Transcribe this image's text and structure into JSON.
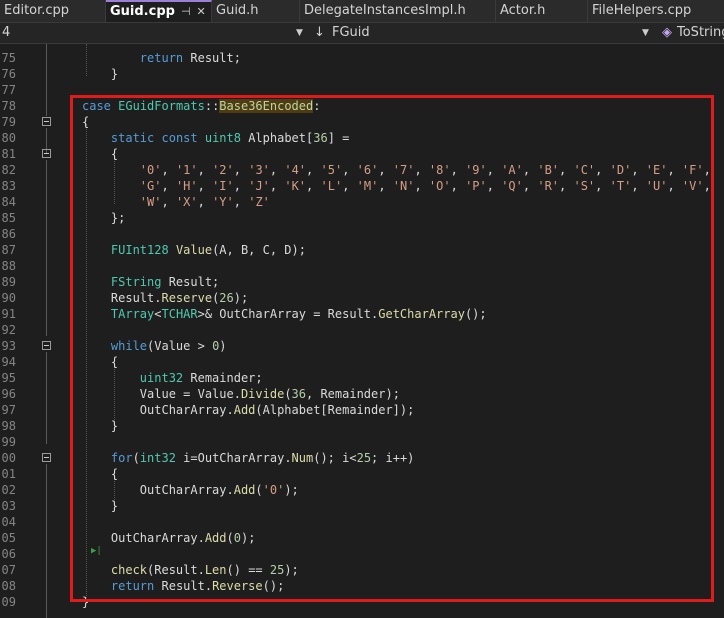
{
  "tabs": [
    {
      "label": "Editor.cpp",
      "active": false
    },
    {
      "label": "Guid.cpp",
      "active": true
    },
    {
      "label": "Guid.h",
      "active": false
    },
    {
      "label": "DelegateInstancesImpl.h",
      "active": false
    },
    {
      "label": "Actor.h",
      "active": false
    },
    {
      "label": "FileHelpers.cpp",
      "active": false
    }
  ],
  "tab_icons": {
    "pin": "pin-icon",
    "close": "close-icon"
  },
  "navbar": {
    "project": "4",
    "scope": "FGuid",
    "member": "ToString"
  },
  "highlight_color": "#e01b1b",
  "lines": [
    {
      "num": "75",
      "tokens": [
        [
          "        ",
          "d"
        ],
        [
          "return",
          "k"
        ],
        [
          " Result",
          "d"
        ],
        [
          ";",
          "d"
        ]
      ]
    },
    {
      "num": "76",
      "tokens": [
        [
          "    }",
          "d"
        ]
      ]
    },
    {
      "num": "77",
      "tokens": [
        [
          "",
          "d"
        ]
      ]
    },
    {
      "num": "78",
      "tokens": [
        [
          "case",
          "k"
        ],
        [
          " ",
          "d"
        ],
        [
          "EGuidFormats",
          "t"
        ],
        [
          "::",
          "d"
        ],
        [
          "Base36Encoded",
          "enumv"
        ],
        [
          ":",
          "d"
        ]
      ]
    },
    {
      "num": "79",
      "tokens": [
        [
          "{",
          "d"
        ]
      ]
    },
    {
      "num": "80",
      "tokens": [
        [
          "    ",
          "d"
        ],
        [
          "static",
          "k"
        ],
        [
          " ",
          "d"
        ],
        [
          "const",
          "k"
        ],
        [
          " ",
          "d"
        ],
        [
          "uint8",
          "t"
        ],
        [
          " Alphabet[",
          "d"
        ],
        [
          "36",
          "n"
        ],
        [
          "] =",
          "d"
        ]
      ]
    },
    {
      "num": "81",
      "tokens": [
        [
          "    {",
          "d"
        ]
      ]
    },
    {
      "num": "82",
      "tokens": [
        [
          "        ",
          "d"
        ],
        [
          "'0'",
          "s"
        ],
        [
          ", ",
          "d"
        ],
        [
          "'1'",
          "s"
        ],
        [
          ", ",
          "d"
        ],
        [
          "'2'",
          "s"
        ],
        [
          ", ",
          "d"
        ],
        [
          "'3'",
          "s"
        ],
        [
          ", ",
          "d"
        ],
        [
          "'4'",
          "s"
        ],
        [
          ", ",
          "d"
        ],
        [
          "'5'",
          "s"
        ],
        [
          ", ",
          "d"
        ],
        [
          "'6'",
          "s"
        ],
        [
          ", ",
          "d"
        ],
        [
          "'7'",
          "s"
        ],
        [
          ", ",
          "d"
        ],
        [
          "'8'",
          "s"
        ],
        [
          ", ",
          "d"
        ],
        [
          "'9'",
          "s"
        ],
        [
          ", ",
          "d"
        ],
        [
          "'A'",
          "s"
        ],
        [
          ", ",
          "d"
        ],
        [
          "'B'",
          "s"
        ],
        [
          ", ",
          "d"
        ],
        [
          "'C'",
          "s"
        ],
        [
          ", ",
          "d"
        ],
        [
          "'D'",
          "s"
        ],
        [
          ", ",
          "d"
        ],
        [
          "'E'",
          "s"
        ],
        [
          ", ",
          "d"
        ],
        [
          "'F'",
          "s"
        ],
        [
          ",",
          "d"
        ]
      ]
    },
    {
      "num": "83",
      "tokens": [
        [
          "        ",
          "d"
        ],
        [
          "'G'",
          "s"
        ],
        [
          ", ",
          "d"
        ],
        [
          "'H'",
          "s"
        ],
        [
          ", ",
          "d"
        ],
        [
          "'I'",
          "s"
        ],
        [
          ", ",
          "d"
        ],
        [
          "'J'",
          "s"
        ],
        [
          ", ",
          "d"
        ],
        [
          "'K'",
          "s"
        ],
        [
          ", ",
          "d"
        ],
        [
          "'L'",
          "s"
        ],
        [
          ", ",
          "d"
        ],
        [
          "'M'",
          "s"
        ],
        [
          ", ",
          "d"
        ],
        [
          "'N'",
          "s"
        ],
        [
          ", ",
          "d"
        ],
        [
          "'O'",
          "s"
        ],
        [
          ", ",
          "d"
        ],
        [
          "'P'",
          "s"
        ],
        [
          ", ",
          "d"
        ],
        [
          "'Q'",
          "s"
        ],
        [
          ", ",
          "d"
        ],
        [
          "'R'",
          "s"
        ],
        [
          ", ",
          "d"
        ],
        [
          "'S'",
          "s"
        ],
        [
          ", ",
          "d"
        ],
        [
          "'T'",
          "s"
        ],
        [
          ", ",
          "d"
        ],
        [
          "'U'",
          "s"
        ],
        [
          ", ",
          "d"
        ],
        [
          "'V'",
          "s"
        ],
        [
          ",",
          "d"
        ]
      ]
    },
    {
      "num": "84",
      "tokens": [
        [
          "        ",
          "d"
        ],
        [
          "'W'",
          "s"
        ],
        [
          ", ",
          "d"
        ],
        [
          "'X'",
          "s"
        ],
        [
          ", ",
          "d"
        ],
        [
          "'Y'",
          "s"
        ],
        [
          ", ",
          "d"
        ],
        [
          "'Z'",
          "s"
        ]
      ]
    },
    {
      "num": "85",
      "tokens": [
        [
          "    };",
          "d"
        ]
      ]
    },
    {
      "num": "86",
      "tokens": [
        [
          "",
          "d"
        ]
      ]
    },
    {
      "num": "87",
      "tokens": [
        [
          "    ",
          "d"
        ],
        [
          "FUInt128",
          "t"
        ],
        [
          " ",
          "d"
        ],
        [
          "Value",
          "f"
        ],
        [
          "(A, B, C, D);",
          "d"
        ]
      ]
    },
    {
      "num": "88",
      "tokens": [
        [
          "",
          "d"
        ]
      ]
    },
    {
      "num": "89",
      "tokens": [
        [
          "    ",
          "d"
        ],
        [
          "FString",
          "t"
        ],
        [
          " Result;",
          "d"
        ]
      ]
    },
    {
      "num": "90",
      "tokens": [
        [
          "    Result.",
          "d"
        ],
        [
          "Reserve",
          "f"
        ],
        [
          "(",
          "d"
        ],
        [
          "26",
          "n"
        ],
        [
          ");",
          "d"
        ]
      ]
    },
    {
      "num": "91",
      "tokens": [
        [
          "    ",
          "d"
        ],
        [
          "TArray",
          "t"
        ],
        [
          "<",
          "d"
        ],
        [
          "TCHAR",
          "t"
        ],
        [
          ">& OutCharArray = Result.",
          "d"
        ],
        [
          "GetCharArray",
          "f"
        ],
        [
          "();",
          "d"
        ]
      ]
    },
    {
      "num": "92",
      "tokens": [
        [
          "",
          "d"
        ]
      ]
    },
    {
      "num": "93",
      "tokens": [
        [
          "    ",
          "d"
        ],
        [
          "while",
          "k"
        ],
        [
          "(Value > ",
          "d"
        ],
        [
          "0",
          "n"
        ],
        [
          ")",
          "d"
        ]
      ]
    },
    {
      "num": "94",
      "tokens": [
        [
          "    {",
          "d"
        ]
      ]
    },
    {
      "num": "95",
      "tokens": [
        [
          "        ",
          "d"
        ],
        [
          "uint32",
          "t"
        ],
        [
          " Remainder;",
          "d"
        ]
      ]
    },
    {
      "num": "96",
      "tokens": [
        [
          "        Value = Value.",
          "d"
        ],
        [
          "Divide",
          "f"
        ],
        [
          "(",
          "d"
        ],
        [
          "36",
          "n"
        ],
        [
          ", Remainder);",
          "d"
        ]
      ]
    },
    {
      "num": "97",
      "tokens": [
        [
          "        OutCharArray.",
          "d"
        ],
        [
          "Add",
          "f"
        ],
        [
          "(Alphabet[Remainder]);",
          "d"
        ]
      ]
    },
    {
      "num": "98",
      "tokens": [
        [
          "    }",
          "d"
        ]
      ]
    },
    {
      "num": "99",
      "tokens": [
        [
          "",
          "d"
        ]
      ]
    },
    {
      "num": "00",
      "tokens": [
        [
          "    ",
          "d"
        ],
        [
          "for",
          "k"
        ],
        [
          "(",
          "d"
        ],
        [
          "int32",
          "t"
        ],
        [
          " i=OutCharArray.",
          "d"
        ],
        [
          "Num",
          "f"
        ],
        [
          "(); i<",
          "d"
        ],
        [
          "25",
          "n"
        ],
        [
          "; i++)",
          "d"
        ]
      ]
    },
    {
      "num": "01",
      "tokens": [
        [
          "    {",
          "d"
        ]
      ]
    },
    {
      "num": "02",
      "tokens": [
        [
          "        OutCharArray.",
          "d"
        ],
        [
          "Add",
          "f"
        ],
        [
          "(",
          "d"
        ],
        [
          "'0'",
          "s"
        ],
        [
          ");",
          "d"
        ]
      ]
    },
    {
      "num": "03",
      "tokens": [
        [
          "    }",
          "d"
        ]
      ]
    },
    {
      "num": "04",
      "tokens": [
        [
          "",
          "d"
        ]
      ]
    },
    {
      "num": "05",
      "tokens": [
        [
          "    OutCharArray.",
          "d"
        ],
        [
          "Add",
          "f"
        ],
        [
          "(",
          "d"
        ],
        [
          "0",
          "n"
        ],
        [
          ");",
          "d"
        ]
      ]
    },
    {
      "num": "06",
      "tokens": [
        [
          "",
          "d"
        ]
      ]
    },
    {
      "num": "07",
      "tokens": [
        [
          "    ",
          "d"
        ],
        [
          "check",
          "f"
        ],
        [
          "(Result.",
          "d"
        ],
        [
          "Len",
          "f"
        ],
        [
          "() == ",
          "d"
        ],
        [
          "25",
          "n"
        ],
        [
          ");",
          "d"
        ]
      ]
    },
    {
      "num": "08",
      "tokens": [
        [
          "    ",
          "d"
        ],
        [
          "return",
          "k"
        ],
        [
          " Result.",
          "d"
        ],
        [
          "Reverse",
          "f"
        ],
        [
          "();",
          "d"
        ]
      ]
    },
    {
      "num": "09",
      "tokens": [
        [
          "}",
          "d"
        ]
      ]
    }
  ]
}
